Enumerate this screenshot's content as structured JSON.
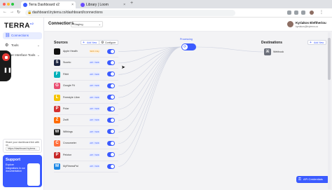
{
  "browser": {
    "tabs": [
      {
        "label": "Terra Dashboard v2",
        "close": "×",
        "favicon_color": "#3b5bff",
        "active": true
      },
      {
        "label": "Library | Loom",
        "close": "×",
        "favicon_color": "#6a4cff",
        "active": false
      }
    ],
    "new_tab": "+",
    "url": "dashboard.tryterra.co/dashboard/connections",
    "nav": {
      "back": "←",
      "forward": "→",
      "reload": "↻"
    },
    "traffic_colors": [
      "#ff5f57",
      "#febc2e",
      "#28c840"
    ]
  },
  "sidebar": {
    "logo": "TERRA",
    "logo_sup": "v2",
    "items": [
      {
        "label": "Connections",
        "icon": "link-icon",
        "glyph": "⛓",
        "active": true
      },
      {
        "label": "Tools",
        "icon": "wrench-icon",
        "glyph": "⚙",
        "chev": "⌄"
      },
      {
        "label": "er Interface Tools",
        "icon": "cog-icon",
        "glyph": "⚙",
        "chev": "⌄"
      }
    ],
    "share": {
      "text": "Share your dashboard link with us",
      "value": "https://dashboard.tryterra..."
    },
    "support": {
      "title": "Support",
      "desc": "Explore integrations in our documentation"
    }
  },
  "recorder": {
    "pause": "❚❚"
  },
  "header": {
    "title": "Connections",
    "env_select": "Staging",
    "env_chevron": "⌄",
    "user_name": "Kyriakos Eleftheriou",
    "user_email": "kyriakos@tryterra.co"
  },
  "sources": {
    "label": "Sources",
    "add_new": "Add New",
    "configure": "Configure",
    "items": [
      {
        "name": "Apple Health",
        "badge": "SDK Only",
        "badge_kind": "warn",
        "glyph": "",
        "color": "#111111"
      },
      {
        "name": "Suunto",
        "badge": "API / SDK",
        "badge_kind": "ok",
        "glyph": "S",
        "color": "#1c2540"
      },
      {
        "name": "Fitbit",
        "badge": "API / SDK",
        "badge_kind": "ok",
        "glyph": "F",
        "color": "#00b0b9"
      },
      {
        "name": "Google Fit",
        "badge": "API / SDK",
        "badge_kind": "ok",
        "glyph": "G",
        "color": "#e94c70"
      },
      {
        "name": "Freestyle Libre",
        "badge": "API / SDK",
        "badge_kind": "ok",
        "glyph": "L",
        "color": "#f5c400"
      },
      {
        "name": "Polar",
        "badge": "API / SDK",
        "badge_kind": "ok",
        "glyph": "P",
        "color": "#d32f2f"
      },
      {
        "name": "Zwift",
        "badge": "API / SDK",
        "badge_kind": "ok",
        "glyph": "Z",
        "color": "#ff6b00"
      },
      {
        "name": "Withings",
        "badge": "API / SDK",
        "badge_kind": "ok",
        "glyph": "W",
        "color": "#222222"
      },
      {
        "name": "Cronometer",
        "badge": "API / SDK",
        "badge_kind": "ok",
        "glyph": "C",
        "color": "#ff6f3c"
      },
      {
        "name": "Peloton",
        "badge": "API / SDK",
        "badge_kind": "ok",
        "glyph": "P",
        "color": "#c62828"
      },
      {
        "name": "MyFitnessPal",
        "badge": "API / SDK",
        "badge_kind": "ok",
        "glyph": "M",
        "color": "#1e88e5"
      }
    ]
  },
  "processing": {
    "label": "Processing",
    "glyph": "⟳"
  },
  "destinations": {
    "label": "Destinations",
    "add_new": "Add New",
    "items": [
      {
        "name": "Webhook",
        "glyph": "⌘"
      }
    ]
  },
  "api_button": {
    "label": "API Credentials",
    "glyph": "⚿"
  }
}
